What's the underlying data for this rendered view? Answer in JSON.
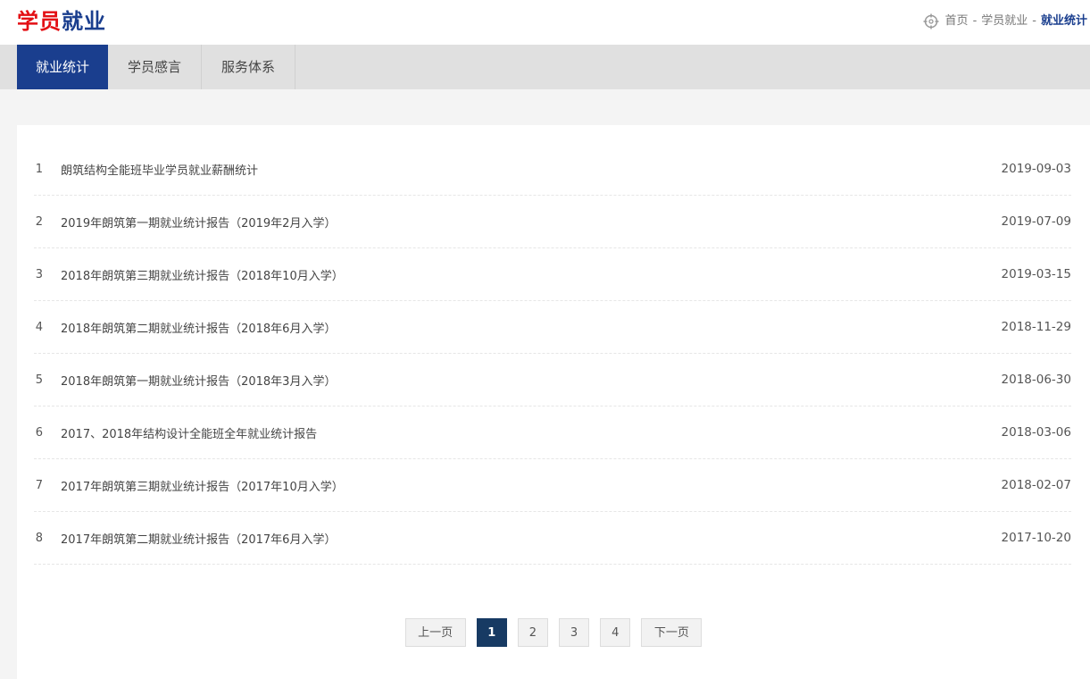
{
  "brand": {
    "part1": "学员",
    "part2": "就业"
  },
  "breadcrumb": {
    "items": [
      "首页",
      "学员就业",
      "就业统计"
    ],
    "separator": "-"
  },
  "tabs": [
    {
      "label": "就业统计",
      "active": true
    },
    {
      "label": "学员感言",
      "active": false
    },
    {
      "label": "服务体系",
      "active": false
    }
  ],
  "list": [
    {
      "num": "1",
      "title": "朗筑结构全能班毕业学员就业薪酬统计",
      "date": "2019-09-03"
    },
    {
      "num": "2",
      "title": "2019年朗筑第一期就业统计报告（2019年2月入学）",
      "date": "2019-07-09"
    },
    {
      "num": "3",
      "title": "2018年朗筑第三期就业统计报告（2018年10月入学）",
      "date": "2019-03-15"
    },
    {
      "num": "4",
      "title": "2018年朗筑第二期就业统计报告（2018年6月入学）",
      "date": "2018-11-29"
    },
    {
      "num": "5",
      "title": "2018年朗筑第一期就业统计报告（2018年3月入学）",
      "date": "2018-06-30"
    },
    {
      "num": "6",
      "title": "2017、2018年结构设计全能班全年就业统计报告",
      "date": "2018-03-06"
    },
    {
      "num": "7",
      "title": "2017年朗筑第三期就业统计报告（2017年10月入学）",
      "date": "2018-02-07"
    },
    {
      "num": "8",
      "title": "2017年朗筑第二期就业统计报告（2017年6月入学）",
      "date": "2017-10-20"
    }
  ],
  "pager": {
    "prev": "上一页",
    "pages": [
      "1",
      "2",
      "3",
      "4"
    ],
    "current": "1",
    "next": "下一页"
  },
  "colors": {
    "brand_red": "#e30f14",
    "brand_blue": "#1a3e8e",
    "pager_active": "#173a63"
  }
}
